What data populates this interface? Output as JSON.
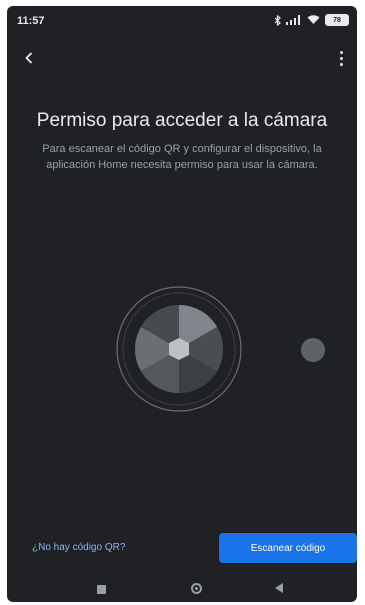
{
  "status_bar": {
    "time": "11:57",
    "battery_level": "78"
  },
  "header": {
    "title": "Permiso para acceder a la cámara",
    "description": "Para escanear el código QR y configurar el dispositivo, la aplicación Home necesita permiso para usar la cámara."
  },
  "actions": {
    "no_qr_label": "¿No hay código QR?",
    "scan_label": "Escanear código"
  },
  "colors": {
    "background": "#202124",
    "accent": "#1a73e8",
    "link": "#8ab4f8"
  },
  "icons": {
    "back": "back-arrow-icon",
    "more": "more-vert-icon",
    "illustration": "camera-aperture-icon"
  }
}
